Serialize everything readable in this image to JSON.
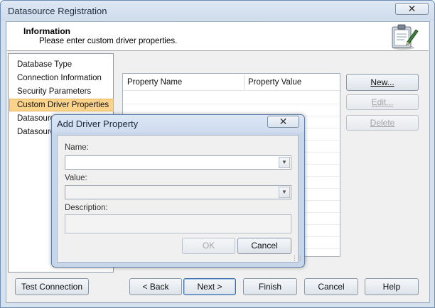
{
  "window": {
    "title": "Datasource Registration",
    "close_glyph": "✕"
  },
  "info": {
    "title": "Information",
    "description": "Please enter custom driver properties.",
    "icon": "clipboard-pen-icon"
  },
  "steps": [
    {
      "label": "Database Type"
    },
    {
      "label": "Connection Information"
    },
    {
      "label": "Security Parameters"
    },
    {
      "label": "Custom Driver Properties",
      "selected": true
    },
    {
      "label": "Datasource"
    },
    {
      "label": "Datasource"
    }
  ],
  "grid": {
    "columns": [
      "Property Name",
      "Property Value"
    ]
  },
  "side_buttons": {
    "new_label": "New...",
    "edit_label": "Edit...",
    "delete_label": "Delete"
  },
  "footer": {
    "test_label": "Test Connection",
    "back_label": "< Back",
    "next_label": "Next >",
    "finish_label": "Finish",
    "cancel_label": "Cancel",
    "help_label": "Help"
  },
  "dialog": {
    "title": "Add Driver Property",
    "close_glyph": "✕",
    "name_label": "Name:",
    "name_value": "",
    "value_label": "Value:",
    "value_value": "",
    "description_label": "Description:",
    "description_value": "",
    "ok_label": "OK",
    "cancel_label": "Cancel"
  }
}
